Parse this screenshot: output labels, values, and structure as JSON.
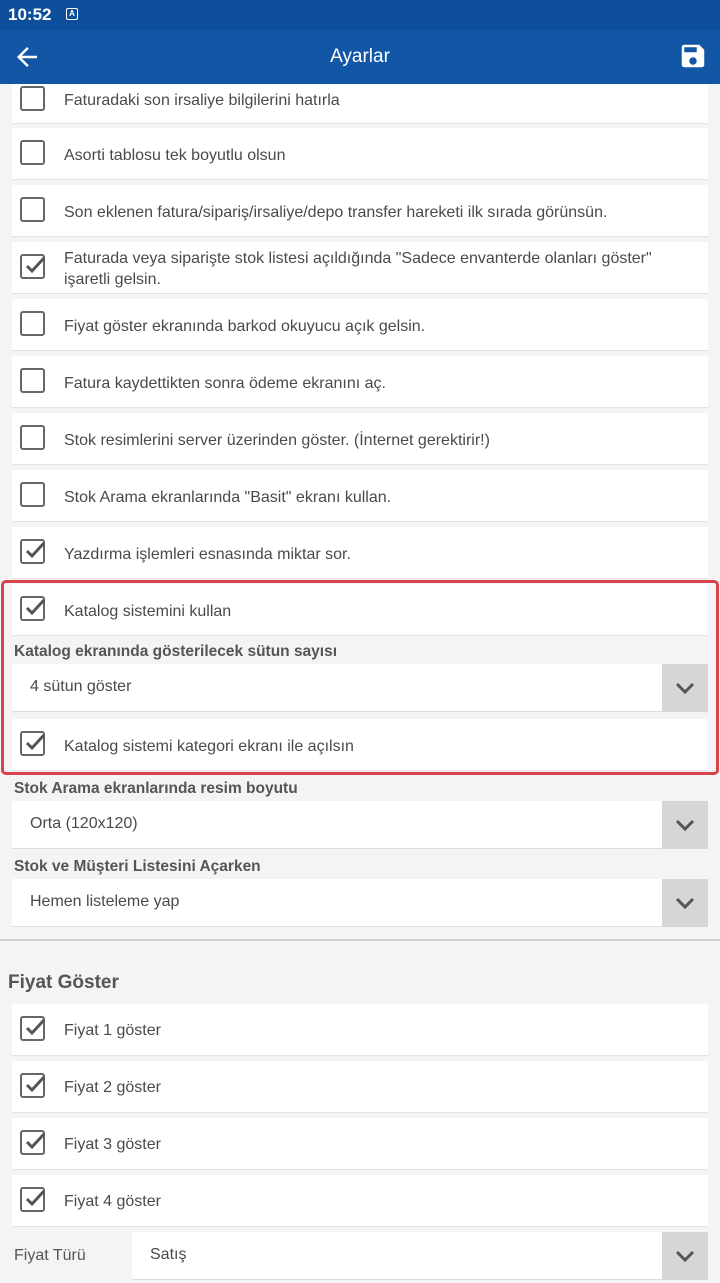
{
  "status_bar": {
    "time": "10:52"
  },
  "app_bar": {
    "title": "Ayarlar"
  },
  "options": [
    {
      "label": "Faturadaki son irsaliye bilgilerini hatırla",
      "checked": false
    },
    {
      "label": "Asorti tablosu tek boyutlu olsun",
      "checked": false
    },
    {
      "label": "Son eklenen fatura/sipariş/irsaliye/depo transfer hareketi ilk sırada görünsün.",
      "checked": false
    },
    {
      "label": "Faturada veya siparişte stok listesi açıldığında \"Sadece envanterde olanları göster\" işaretli gelsin.",
      "checked": true
    },
    {
      "label": "Fiyat göster ekranında barkod okuyucu açık gelsin.",
      "checked": false
    },
    {
      "label": "Fatura kaydettikten sonra ödeme ekranını aç.",
      "checked": false
    },
    {
      "label": "Stok resimlerini server üzerinden göster. (İnternet gerektirir!)",
      "checked": false
    },
    {
      "label": "Stok Arama ekranlarında \"Basit\" ekranı kullan.",
      "checked": false
    },
    {
      "label": "Yazdırma işlemleri esnasında miktar sor.",
      "checked": true
    }
  ],
  "catalog": {
    "use_catalog": {
      "label": "Katalog sistemini kullan",
      "checked": true
    },
    "columns_label": "Katalog ekranında gösterilecek sütun sayısı",
    "columns_value": "4 sütun göster",
    "category_open": {
      "label": "Katalog sistemi kategori ekranı ile açılsın",
      "checked": true
    }
  },
  "image_size": {
    "label": "Stok Arama ekranlarında resim boyutu",
    "value": "Orta (120x120)"
  },
  "list_open": {
    "label": "Stok ve Müşteri Listesini Açarken",
    "value": "Hemen listeleme yap"
  },
  "price_section": {
    "title": "Fiyat Göster",
    "items": [
      {
        "label": "Fiyat 1 göster",
        "checked": true
      },
      {
        "label": "Fiyat 2 göster",
        "checked": true
      },
      {
        "label": "Fiyat 3 göster",
        "checked": true
      },
      {
        "label": "Fiyat 4 göster",
        "checked": true
      }
    ],
    "price_type_label": "Fiyat Türü",
    "price_type_value": "Satış"
  },
  "colors": {
    "appbar": "#1157a6",
    "statusbar": "#0d4f9a",
    "highlight": "#d9434a"
  }
}
